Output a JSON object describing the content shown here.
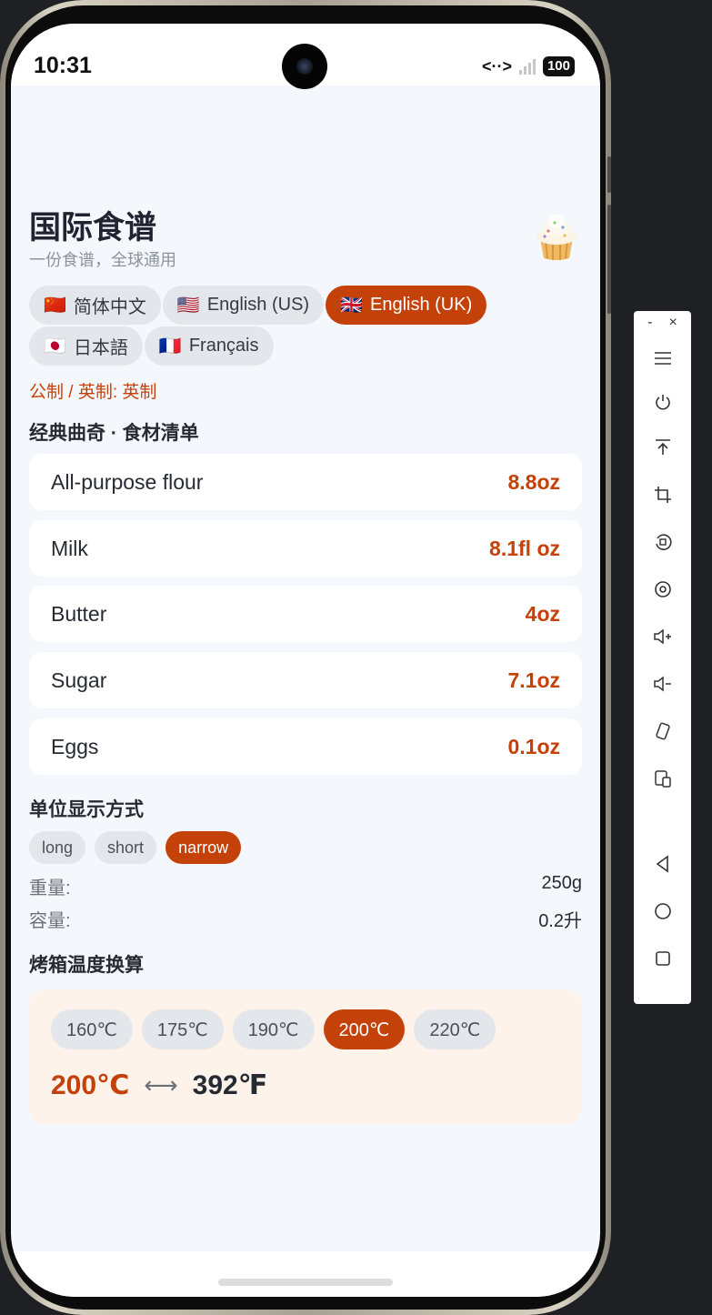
{
  "status_bar": {
    "time": "10:31",
    "network_icon": "<··>",
    "battery": "100"
  },
  "app": {
    "title": "国际食谱",
    "subtitle": "一份食谱，全球通用",
    "languages": [
      {
        "flag": "🇨🇳",
        "label": "简体中文",
        "active": false
      },
      {
        "flag": "🇺🇸",
        "label": "English (US)",
        "active": false
      },
      {
        "flag": "🇬🇧",
        "label": "English (UK)",
        "active": true
      },
      {
        "flag": "🇯🇵",
        "label": "日本語",
        "active": false
      },
      {
        "flag": "🇫🇷",
        "label": "Français",
        "active": false
      }
    ],
    "unit_system": "公制 / 英制: 英制",
    "ingredients_heading": "经典曲奇 · 食材清单",
    "ingredients": [
      {
        "name": "All-purpose flour",
        "qty": "8.8oz"
      },
      {
        "name": "Milk",
        "qty": "8.1fl oz"
      },
      {
        "name": "Butter",
        "qty": "4oz"
      },
      {
        "name": "Sugar",
        "qty": "7.1oz"
      },
      {
        "name": "Eggs",
        "qty": "0.1oz"
      }
    ],
    "unit_display_heading": "单位显示方式",
    "unit_display_options": [
      {
        "label": "long",
        "active": false
      },
      {
        "label": "short",
        "active": false
      },
      {
        "label": "narrow",
        "active": true
      }
    ],
    "weight_label": "重量:",
    "weight_value": "250g",
    "volume_label": "容量:",
    "volume_value": "0.2升",
    "oven_heading": "烤箱温度换算",
    "temps": [
      {
        "label": "160℃",
        "active": false
      },
      {
        "label": "175℃",
        "active": false
      },
      {
        "label": "190℃",
        "active": false
      },
      {
        "label": "200℃",
        "active": true
      },
      {
        "label": "220℃",
        "active": false
      }
    ],
    "temp_celsius": "200℃",
    "temp_arrow": "⟷",
    "temp_fahrenheit": "392℉"
  },
  "emulator_toolbar": {
    "minimize": "-",
    "close": "×",
    "buttons": [
      "menu-icon",
      "power-icon",
      "pin-top-icon",
      "crop-icon",
      "rotate-icon",
      "screenshot-icon",
      "volume-up-icon",
      "volume-down-icon",
      "shake-icon",
      "multi-device-icon",
      "back-icon",
      "home-icon",
      "recents-icon"
    ]
  },
  "colors": {
    "accent": "#c5410a",
    "background": "#f4f7fb",
    "card": "#ffffff",
    "temp_card": "#fdf3ea"
  }
}
